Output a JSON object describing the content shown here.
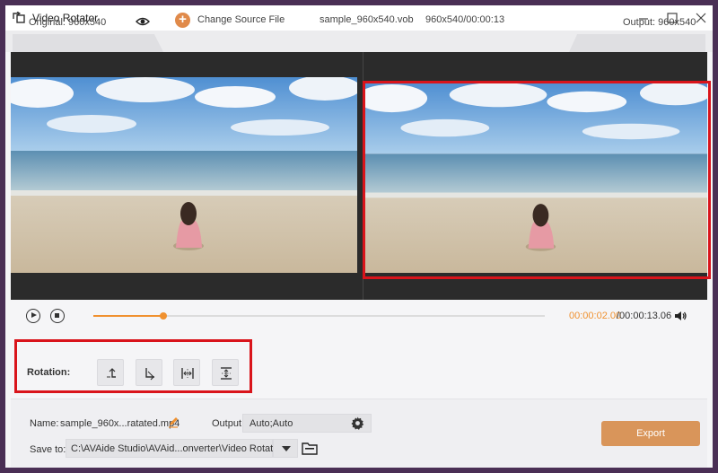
{
  "window": {
    "title": "Video Rotator",
    "icon": "rotate-app-icon"
  },
  "info_bar": {
    "original_label": "Original: 960x540",
    "change_source_label": "Change Source File",
    "file_name": "sample_960x540.vob",
    "file_meta": "960x540/00:00:13",
    "output_label": "Output: 960x540"
  },
  "playback": {
    "current_time": "00:00:02.00",
    "total_time": "/00:00:13.06",
    "progress": 0.156,
    "accent_color": "#f0912f"
  },
  "rotation": {
    "label": "Rotation:",
    "buttons": [
      {
        "name": "rotate-left",
        "icon": "rotate-left-icon"
      },
      {
        "name": "rotate-right",
        "icon": "rotate-right-icon"
      },
      {
        "name": "flip-horizontal",
        "icon": "flip-horizontal-icon"
      },
      {
        "name": "flip-vertical",
        "icon": "flip-vertical-icon"
      }
    ],
    "highlight_color": "#d9141b"
  },
  "bottom": {
    "name_label": "Name:",
    "name_value": "sample_960x...ratated.mp4",
    "output_label": "Output:",
    "output_value": "Auto;Auto",
    "save_to_label": "Save to:",
    "save_path": "C:\\AVAide Studio\\AVAid...onverter\\Video Rotator",
    "export_label": "Export",
    "export_color": "#d9955a"
  }
}
